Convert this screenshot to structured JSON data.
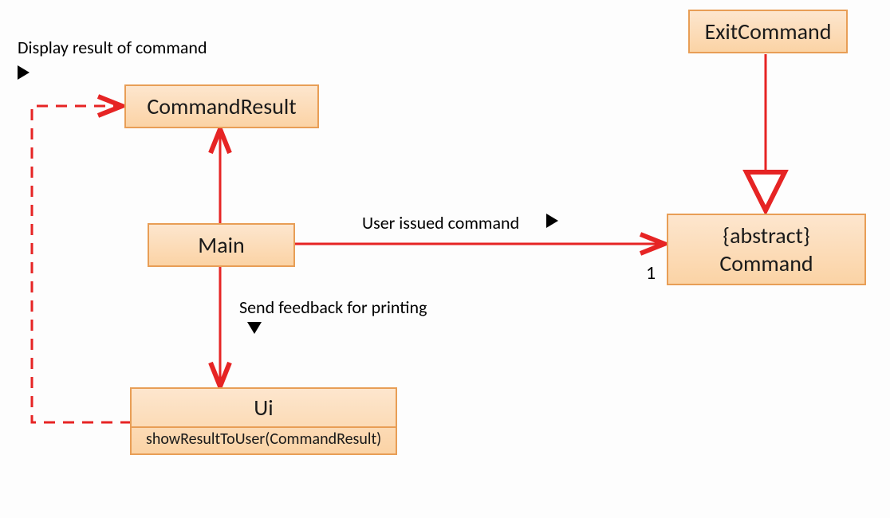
{
  "boxes": {
    "exitCommand": "ExitCommand",
    "commandResult": "CommandResult",
    "main": "Main",
    "ui": "Ui",
    "uiMethod": "showResultToUser(CommandResult)",
    "commandStereotype": "{abstract}",
    "commandName": "Command"
  },
  "labels": {
    "displayResult": "Display result of command",
    "userIssued": "User issued command",
    "sendFeedback": "Send feedback for printing"
  },
  "multiplicity": "1"
}
